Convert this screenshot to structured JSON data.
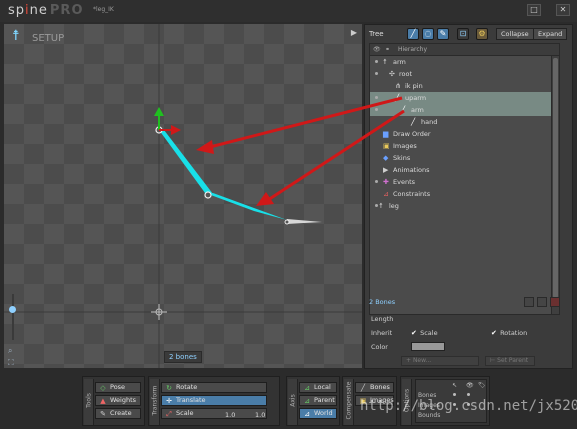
{
  "app": {
    "logo_a": "sp",
    "logo_o": "i",
    "logo_b": "ne",
    "logo_pro": "PRO",
    "filename": "*leg_IK"
  },
  "window": {
    "max_label": "□",
    "close_label": "✕"
  },
  "viewport": {
    "mode_label": "SETUP",
    "play_label": "▶",
    "bone_count": "2 bones"
  },
  "tree_panel": {
    "title": "Tree",
    "collapse_label": "Collapse",
    "expand_label": "Expand",
    "header_label": "Hierarchy",
    "rows": [
      {
        "label": "arm",
        "icon": "skeleton-icon",
        "glyph": "☨",
        "color": "#cfcfcf",
        "dot": true
      },
      {
        "label": "root",
        "icon": "bone-root-icon",
        "glyph": "✣",
        "color": "#cfcfcf",
        "dot": true
      },
      {
        "label": "ik pin",
        "icon": "ik-icon",
        "glyph": "⋔",
        "color": "#cfcfcf",
        "dot": false
      },
      {
        "label": "uparm",
        "icon": "bone-icon",
        "glyph": "╱",
        "color": "#ffffff",
        "dot": true,
        "selected": true
      },
      {
        "label": "arm",
        "icon": "bone-icon",
        "glyph": "╱",
        "color": "#ffffff",
        "dot": true,
        "selected": true
      },
      {
        "label": "hand",
        "icon": "bone-icon",
        "glyph": "╱",
        "color": "#ffffff",
        "dot": false
      },
      {
        "label": "Draw Order",
        "icon": "draw-order-icon",
        "glyph": "▆",
        "color": "#6aa0ff",
        "dot": false
      },
      {
        "label": "Images",
        "icon": "images-icon",
        "glyph": "▣",
        "color": "#e8c85a",
        "dot": false
      },
      {
        "label": "Skins",
        "icon": "skins-icon",
        "glyph": "◆",
        "color": "#6aa0ff",
        "dot": false
      },
      {
        "label": "Animations",
        "icon": "animations-icon",
        "glyph": "▶",
        "color": "#cfcfcf",
        "dot": false
      },
      {
        "label": "Events",
        "icon": "events-icon",
        "glyph": "✚",
        "color": "#d070d0",
        "dot": true
      },
      {
        "label": "Constraints",
        "icon": "constraints-icon",
        "glyph": "⊿",
        "color": "#e06060",
        "dot": false
      },
      {
        "label": "leg",
        "icon": "skeleton-icon",
        "glyph": "☨",
        "color": "#cfcfcf",
        "dot": true
      }
    ],
    "selection_count": "2 Bones"
  },
  "properties": {
    "length_label": "Length",
    "inherit_label": "Inherit",
    "scale_label": "Scale",
    "rotation_label": "Rotation",
    "color_label": "Color",
    "color_value": "#9a9a9a",
    "new_label": "New...",
    "set_parent_label": "Set Parent"
  },
  "toolbar": {
    "tools_label": "Tools",
    "pose_label": "Pose",
    "weights_label": "Weights",
    "create_label": "Create",
    "transform_label": "Transform",
    "rotate_label": "Rotate",
    "translate_label": "Translate",
    "scale_label": "Scale",
    "scale_x": "1.0",
    "scale_y": "1.0",
    "axis_label": "Axis",
    "local_label": "Local",
    "parent_label": "Parent",
    "world_label": "World",
    "compensate_label": "Compensate",
    "bones_label": "Bones",
    "images_label": "Images",
    "options_label": "Options",
    "opt_bones": "Bones",
    "opt_images": "Images",
    "opt_bounds": "Bounds"
  },
  "watermark": "http://blog.csdn.net/jx520",
  "colors": {
    "bone_color": "#18e0e8",
    "arrow_color": "#d01818",
    "selection_bg": "#788a84",
    "accent": "#4a7da8"
  }
}
